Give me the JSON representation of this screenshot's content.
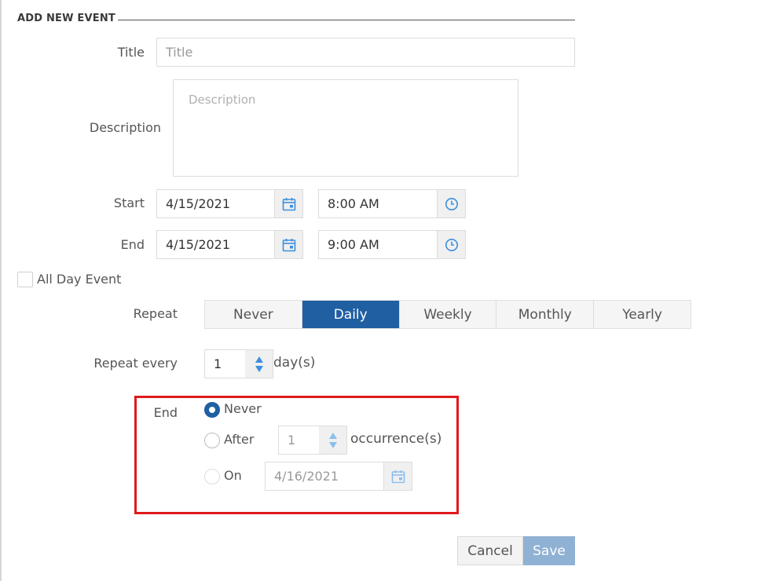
{
  "form": {
    "legend": "ADD NEW EVENT",
    "title_label": "Title",
    "title_placeholder": "Title",
    "title_value": "",
    "description_label": "Description",
    "description_placeholder": "Description",
    "start_label": "Start",
    "start_date": "4/15/2021",
    "start_time": "8:00 AM",
    "end_label": "End",
    "end_date": "4/15/2021",
    "end_time": "9:00 AM",
    "all_day_label": "All Day Event",
    "all_day_checked": false
  },
  "repeat": {
    "label": "Repeat",
    "options": [
      "Never",
      "Daily",
      "Weekly",
      "Monthly",
      "Yearly"
    ],
    "selected": "Daily",
    "every_label": "Repeat every",
    "every_value": "1",
    "every_unit": "day(s)"
  },
  "end_rule": {
    "label": "End",
    "selected": "Never",
    "never_label": "Never",
    "after_label": "After",
    "after_value": "1",
    "after_unit": "occurrence(s)",
    "on_label": "On",
    "on_date": "4/16/2021"
  },
  "actions": {
    "cancel_label": "Cancel",
    "save_label": "Save"
  },
  "colors": {
    "accent": "#1f5fa2",
    "highlight_box": "#e0191c",
    "picker_icon": "#3b8fde",
    "save_disabled": "#8fb1d3"
  },
  "icons": {
    "date_picker": "calendar-icon",
    "time_picker": "clock-icon"
  }
}
